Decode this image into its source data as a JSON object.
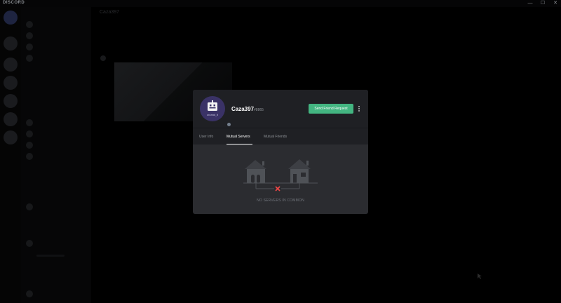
{
  "app": {
    "title": "DISCORD"
  },
  "window_controls": {
    "minimize": "—",
    "maximize": "☐",
    "close": "✕"
  },
  "chat": {
    "header_name": "Caza397"
  },
  "profile": {
    "username": "Caza397",
    "discriminator": "#8865",
    "avatar_text": "un-mod_it",
    "friend_button_label": "Send Friend Request"
  },
  "tabs": [
    {
      "label": "User Info"
    },
    {
      "label": "Mutual Servers"
    },
    {
      "label": "Mutual Friends"
    }
  ],
  "active_tab": "Mutual Servers",
  "empty_state": {
    "message": "NO SERVERS IN COMMON"
  },
  "colors": {
    "accent_green": "#43b581",
    "modal_bg": "#2b2c30",
    "header_bg": "#1f2024",
    "avatar_bg": "#3a3266",
    "error_red": "#f04747"
  }
}
